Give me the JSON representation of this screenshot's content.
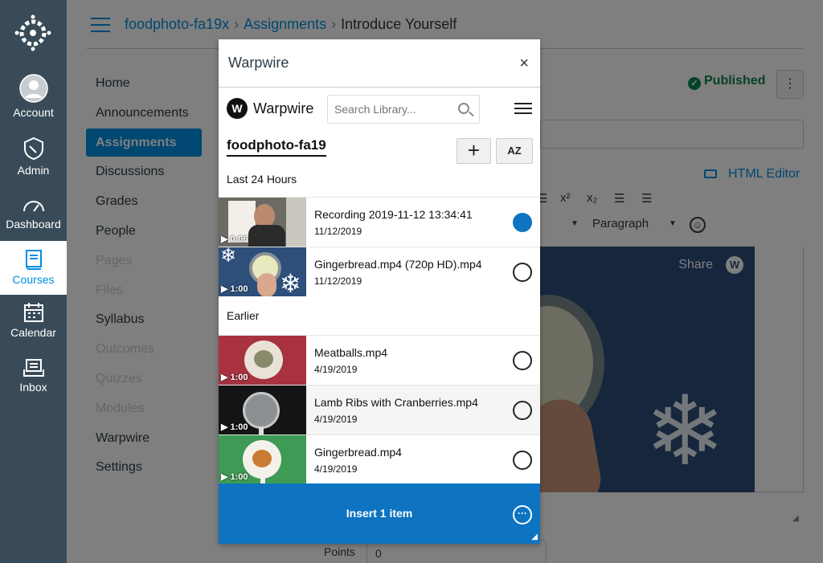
{
  "breadcrumb": {
    "course": "foodphoto-fa19x",
    "section": "Assignments",
    "current": "Introduce Yourself"
  },
  "global_nav": [
    {
      "label": "Account",
      "icon": "account-icon"
    },
    {
      "label": "Admin",
      "icon": "admin-icon"
    },
    {
      "label": "Dashboard",
      "icon": "dashboard-icon"
    },
    {
      "label": "Courses",
      "icon": "courses-icon"
    },
    {
      "label": "Calendar",
      "icon": "calendar-icon"
    },
    {
      "label": "Inbox",
      "icon": "inbox-icon"
    }
  ],
  "course_nav": [
    "Home",
    "Announcements",
    "Assignments",
    "Discussions",
    "Grades",
    "People",
    "Pages",
    "Files",
    "Syllabus",
    "Outcomes",
    "Quizzes",
    "Modules",
    "Warpwire",
    "Settings"
  ],
  "status": {
    "published": "Published"
  },
  "editor": {
    "html_editor": "HTML Editor",
    "paragraph": "Paragraph",
    "share": "Share"
  },
  "points": {
    "label": "Points",
    "value": "0"
  },
  "modal": {
    "title": "Warpwire",
    "close": "×",
    "brand": "Warpwire",
    "search_placeholder": "Search Library...",
    "library": "foodphoto-fa19",
    "sort_label": "AZ",
    "section_recent": "Last 24 Hours",
    "section_earlier": "Earlier",
    "items": [
      {
        "title": "Recording 2019-11-12 13:34:41",
        "date": "11/12/2019",
        "duration": "0:06",
        "selected": true
      },
      {
        "title": "Gingerbread.mp4 (720p HD).mp4",
        "date": "11/12/2019",
        "duration": "1:00",
        "selected": false
      },
      {
        "title": "Meatballs.mp4",
        "date": "4/19/2019",
        "duration": "1:00",
        "selected": false
      },
      {
        "title": "Lamb Ribs with Cranberries.mp4",
        "date": "4/19/2019",
        "duration": "1:00",
        "selected": false
      },
      {
        "title": "Gingerbread.mp4",
        "date": "4/19/2019",
        "duration": "1:00",
        "selected": false
      }
    ],
    "insert_label": "Insert 1 item"
  },
  "colors": {
    "nav_bg": "#394b58",
    "accent": "#008ee2",
    "insert_bar": "#0e74c1",
    "published": "#0b874b"
  }
}
